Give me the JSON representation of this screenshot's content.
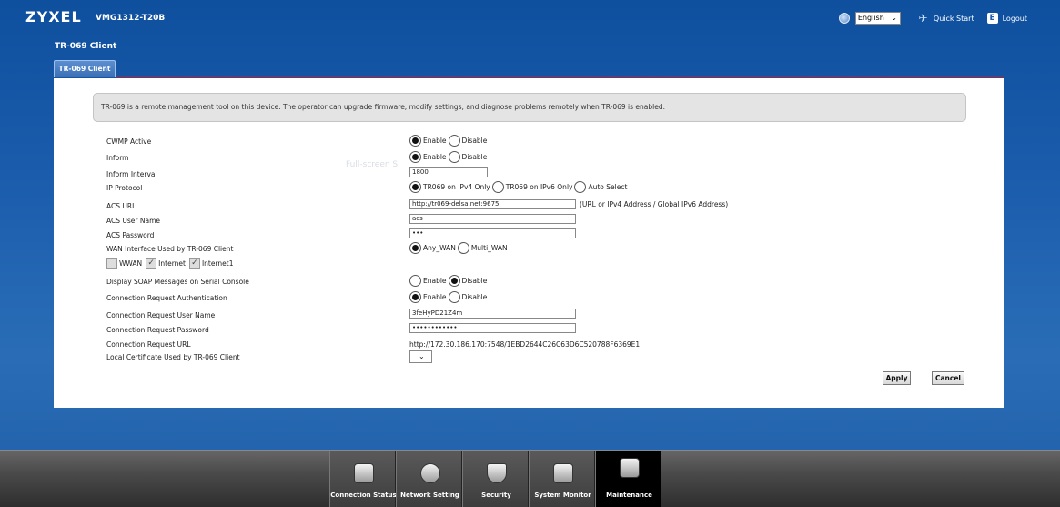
{
  "header": {
    "brand": "ZYXEL",
    "model": "VMG1312-T20B",
    "language": "English",
    "quick_start": "Quick Start",
    "logout": "Logout"
  },
  "page_title": "TR-069 Client",
  "tabs": [
    {
      "label": "TR-069 Client"
    }
  ],
  "info": "TR-069 is a remote management tool on this device. The operator can upgrade firmware, modify settings, and diagnose problems remotely when TR-069 is enabled.",
  "overlay_text": "Full-screen S",
  "form": {
    "cwmp_active": {
      "label": "CWMP Active",
      "opt1": "Enable",
      "opt2": "Disable",
      "selected": "Enable"
    },
    "inform": {
      "label": "Inform",
      "opt1": "Enable",
      "opt2": "Disable",
      "selected": "Enable"
    },
    "inform_interval": {
      "label": "Inform Interval",
      "value": "1800"
    },
    "ip_protocol": {
      "label": "IP Protocol",
      "opt1": "TR069 on IPv4 Only",
      "opt2": "TR069 on IPv6 Only",
      "opt3": "Auto Select",
      "selected": "TR069 on IPv4 Only"
    },
    "acs_url": {
      "label": "ACS URL",
      "value": "http://tr069-delsa.net:9675",
      "hint": "(URL or IPv4 Address / Global IPv6 Address)"
    },
    "acs_user": {
      "label": "ACS User Name",
      "value": "acs"
    },
    "acs_password": {
      "label": "ACS Password",
      "value": "•••"
    },
    "wan_interface": {
      "label": "WAN Interface Used by TR-069 Client",
      "opt1": "Any_WAN",
      "opt2": "Multi_WAN",
      "selected": "Any_WAN"
    },
    "wan_checks": {
      "c1": "WWAN",
      "c2": "Internet",
      "c3": "Internet1"
    },
    "soap": {
      "label": "Display SOAP Messages on Serial Console",
      "opt1": "Enable",
      "opt2": "Disable",
      "selected": "Disable"
    },
    "conn_auth": {
      "label": "Connection Request Authentication",
      "opt1": "Enable",
      "opt2": "Disable",
      "selected": "Enable"
    },
    "conn_user": {
      "label": "Connection Request User Name",
      "value": "3feHyPD21Z4m"
    },
    "conn_password": {
      "label": "Connection Request Password",
      "value": "••••••••••••"
    },
    "conn_url": {
      "label": "Connection Request URL",
      "value": "http://172.30.186.170:7548/1EBD2644C26C63D6C520788F6369E1"
    },
    "local_cert": {
      "label": "Local Certificate Used by TR-069 Client"
    }
  },
  "buttons": {
    "apply": "Apply",
    "cancel": "Cancel"
  },
  "nav": [
    {
      "label": "Connection Status"
    },
    {
      "label": "Network Setting"
    },
    {
      "label": "Security"
    },
    {
      "label": "System Monitor"
    },
    {
      "label": "Maintenance"
    }
  ]
}
